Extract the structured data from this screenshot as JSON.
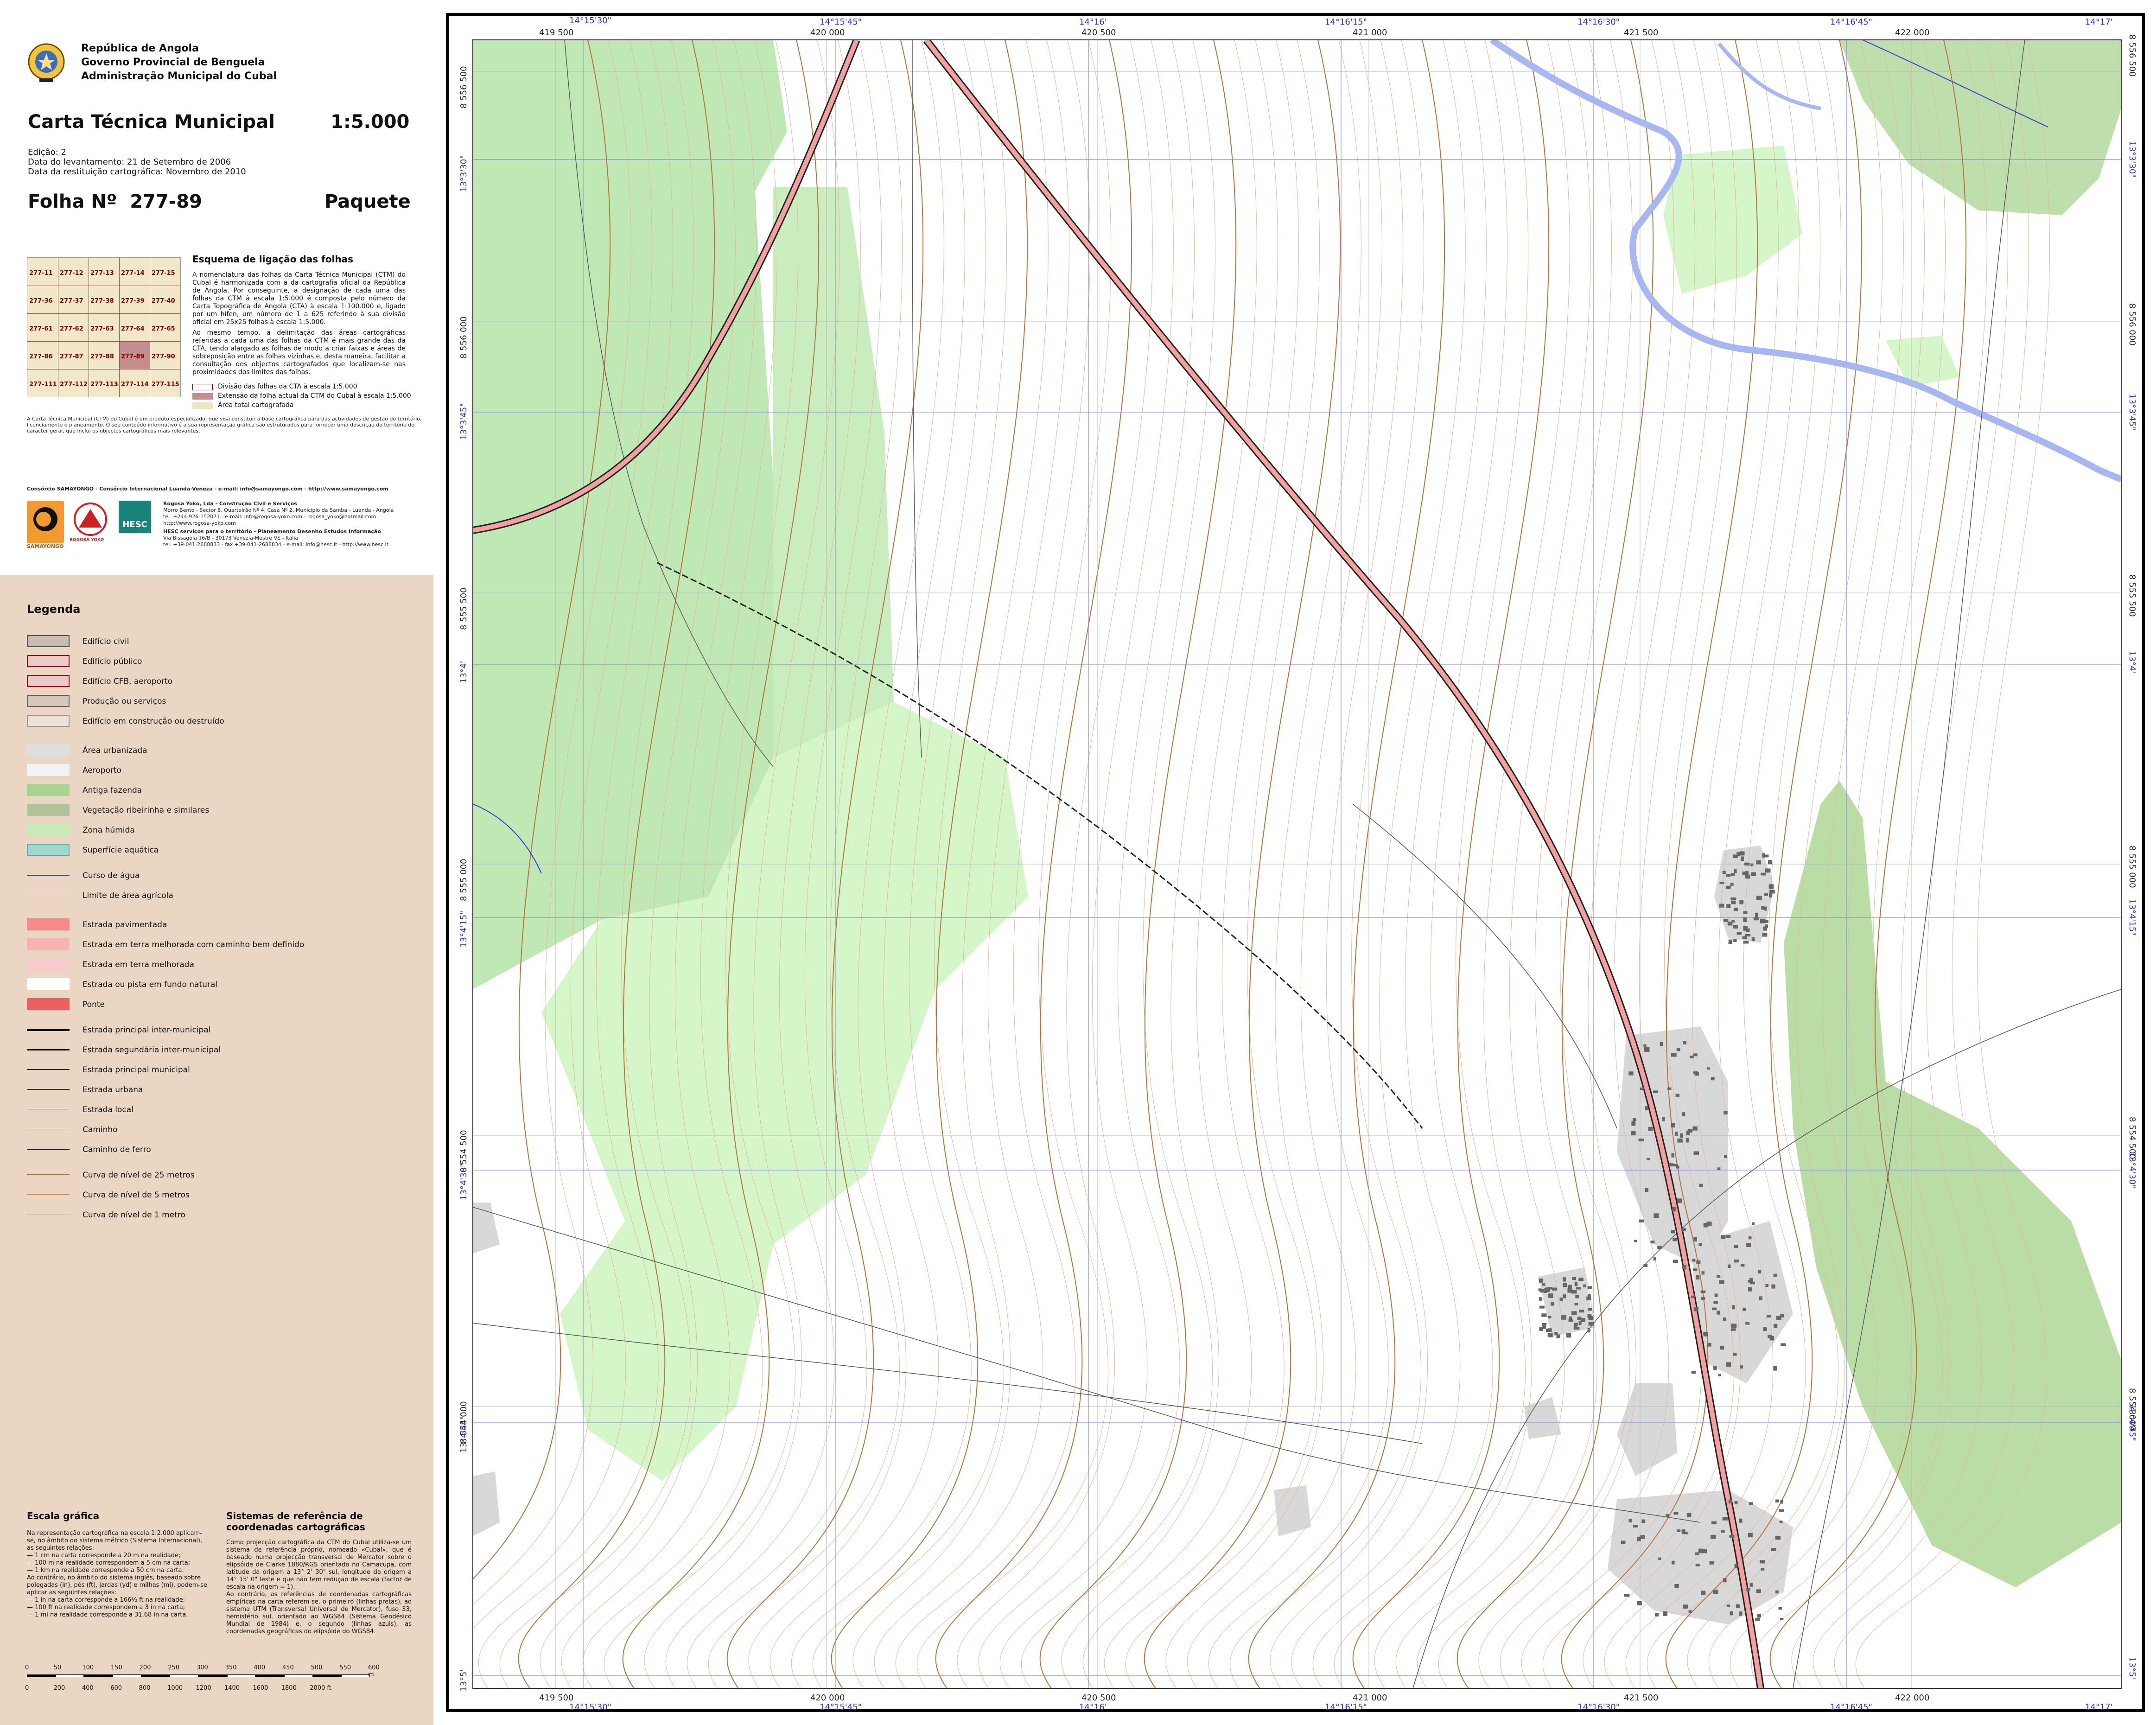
{
  "header": {
    "line1": "República de Angola",
    "line2": "Governo Provincial de Benguela",
    "line3": "Administração Municipal do Cubal",
    "map_title": "Carta Técnica Municipal",
    "scale": "1:5.000",
    "edition": "Edição: 2",
    "survey_date": "Data do levantamento: 21 de Setembro de 2006",
    "restitution_date": "Data da restituição cartográfica: Novembro de 2010",
    "sheet_label": "Folha Nº",
    "sheet_number": "277-89",
    "sheet_name": "Paquete"
  },
  "index_diagram": {
    "title": "Esquema de ligação das folhas",
    "cells": [
      [
        "277-11",
        "277-12",
        "277-13",
        "277-14",
        "277-15"
      ],
      [
        "277-36",
        "277-37",
        "277-38",
        "277-39",
        "277-40"
      ],
      [
        "277-61",
        "277-62",
        "277-63",
        "277-64",
        "277-65"
      ],
      [
        "277-86",
        "277-87",
        "277-88",
        "277-89",
        "277-90"
      ],
      [
        "277-111",
        "277-112",
        "277-113",
        "277-114",
        "277-115"
      ]
    ],
    "current_cell": "277-89",
    "text": "A nomenclatura das folhas da Carta Técnica Municipal (CTM) do Cubal é harmonizada com a da cartografia oficial da República de Angola. Por conseguinte, a designação de cada uma das folhas da CTM à escala 1:5.000 é composta pelo número da Carta Topográfica de Angola (CTA) à escala 1:100.000 e, ligado por um hífen, um número de 1 a 625 referindo à sua divisão oficial em 25x25 folhas à escala 1:5.000.",
    "text2": "Ao mesmo tempo, a delimitação das áreas cartográficas referidas a cada uma das folhas da CTM é mais grande das da CTA, tendo alargado as folhas de modo a criar faixas e áreas de sobreposição entre as folhas vizinhas e, desta maneira, facilitar a consultação dos objectos cartografados que localizam-se nas proximidades dos limites das folhas.",
    "legend1": "Divisão das folhas da CTA à escala 1:5.000",
    "legend2": "Extensão da folha actual da CTM do Cubal à escala 1:5.000",
    "legend3": "Área total cartografada"
  },
  "disclaimer": "A Carta Técnica Municipal (CTM) do Cubal é um produto especializado, que visa constituir a base cartográfica para das actividades de gestão do território, licenciamento e planeamento. O seu conteúdo informativo é a sua representação gráfica são estruturados para fornecer uma descrição do território de caracter geral, que inclui os objectos cartográficos mais relevantes.",
  "consortium": {
    "line": "Consórcio SAMAYONGO - Consórcio Internacional Luanda-Veneza - e-mail: info@samayongo.com - http://www.samayongo.com",
    "rogosa_name": "Rogosa Yoko, Lda - Construção Civil e Serviços",
    "rogosa_addr": "Morro Bento - Sector 8, Quarteirão Nº 4, Casa Nº 2, Município da Samba - Luanda - Angola",
    "rogosa_contact": "tel. +244-926-152071 - e-mail: info@rogosa-yoko.com - rogosa_yoko@hotmail.com",
    "rogosa_web": "http://www.rogosa-yoko.com",
    "hesc_name": "HESC serviços para o território - Planeamento Desenho Estudos Informação",
    "hesc_addr": "Via Bissagola 16/B - 30173 Venezia-Mestre VE - Itália",
    "hesc_contact": "tel. +39-041-2688833 - fax +39-041-2688834 - e-mail: info@hesc.it - http://www.hesc.it",
    "logo_left": "SAMAYONGO",
    "logo_mid": "ROGOSA YOKO",
    "logo_right": "HESC"
  },
  "legend": {
    "title": "Legenda",
    "items": [
      {
        "label": "Edifício civil",
        "fill": "#c9bcb2",
        "stroke": "#555"
      },
      {
        "label": "Edifício público",
        "fill": "#e8cccc",
        "stroke": "#b00000"
      },
      {
        "label": "Edifício CFB, aeroporto",
        "fill": "#e9c9c9",
        "stroke": "#b00000"
      },
      {
        "label": "Produção ou serviços",
        "fill": "#d8c7bb",
        "stroke": "#666"
      },
      {
        "label": "Edifício em construção ou destruído",
        "fill": "#f1e2d7",
        "stroke": "#999"
      },
      {
        "label": "Área urbanizada",
        "fill": "#dedede",
        "stroke": "none"
      },
      {
        "label": "Aeroporto",
        "fill": "#f2f2f2",
        "stroke": "none"
      },
      {
        "label": "Antiga fazenda",
        "fill": "#a8d48f",
        "stroke": "none"
      },
      {
        "label": "Vegetação ribeirinha e similares",
        "fill": "#b4c29a",
        "stroke": "none"
      },
      {
        "label": "Zona húmida",
        "fill": "#c8ecb8",
        "stroke": "none"
      },
      {
        "label": "Superfície aquática",
        "fill": "#9fd8d3",
        "stroke": "#6a9"
      },
      {
        "label": "Curso de água",
        "line": "#3a3ad8",
        "width": 2
      },
      {
        "label": "Limite de área agrícola",
        "line": "#999999",
        "width": 1
      },
      {
        "label": "Estrada pavimentada",
        "fill": "#f58a8a",
        "stroke": "none"
      },
      {
        "label": "Estrada em terra melhorada com caminho bem definido",
        "fill": "#f7b2b2",
        "stroke": "none"
      },
      {
        "label": "Estrada em terra melhorada",
        "fill": "#f8cccc",
        "stroke": "none"
      },
      {
        "label": "Estrada ou pista em fundo natural",
        "fill": "#ffffff",
        "stroke": "none"
      },
      {
        "label": "Ponte",
        "fill": "#ee5e5e",
        "stroke": "none"
      },
      {
        "label": "Estrada principal inter-municipal",
        "line": "#111111",
        "width": 4
      },
      {
        "label": "Estrada segundária inter-municipal",
        "line": "#111111",
        "width": 3
      },
      {
        "label": "Estrada principal municipal",
        "line": "#222222",
        "width": 2
      },
      {
        "label": "Estrada urbana",
        "line": "#333333",
        "width": 2
      },
      {
        "label": "Estrada local",
        "line": "#444444",
        "width": 1.5
      },
      {
        "label": "Caminho",
        "line": "#666666",
        "width": 1
      },
      {
        "label": "Caminho de ferro",
        "line": "#111111",
        "width": 2
      },
      {
        "label": "Curva de nível de 25 metros",
        "line": "#b36a2a",
        "width": 2
      },
      {
        "label": "Curva de nível de 5 metros",
        "line": "#c8885a",
        "width": 1
      },
      {
        "label": "Curva de nível de 1 metro",
        "line": "#e0bca0",
        "width": 1
      }
    ]
  },
  "scale_section": {
    "title": "Escala gráfica",
    "text": "Na representação cartográfica na escala 1:2.000 aplicam-se, no âmbito do sistema métrico (Sistema Internacional), as seguintes relações:\n— 1 cm na carta corresponde a 20 m na realidade;\n— 100 m na realidade correspondem a 5 cm na carta;\n— 1 km na realidade corresponde a 50 cm na carta.\nAo contrário, no âmbito do sistema inglês, baseado sobre polegadas (in), pés (ft), jardas (yd) e milhas (mi), podem-se aplicar as seguintes relações:\n— 1 in na carta corresponde a 166⅔ ft na realidade;\n— 100 ft na realidade correspondem a 3 in na carta;\n— 1 mi na realidade corresponde a 31,68 in na carta.",
    "meters_ticks": [
      "0",
      "50",
      "100",
      "150",
      "200",
      "250",
      "300",
      "350",
      "400",
      "450",
      "500",
      "550",
      "600 m"
    ],
    "feet_ticks": [
      "0",
      "200",
      "400",
      "600",
      "800",
      "1000",
      "1200",
      "1400",
      "1600",
      "1800",
      "2000 ft"
    ]
  },
  "crs_section": {
    "title": "Sistemas de referência de coordenadas cartográficas",
    "text": "Como projecção cartográfica da CTM do Cubal utiliza-se um sistema de referência próprio, nomeado «Cubal», que é baseado numa projecção transversal de Mercator sobre o elipsóide de Clarke 1880/RGS orientado no Camacupa, com latitude da origem a 13° 2' 30\" sul, longitude da origem a 14° 15' 0\" leste e que não tem redução de escala (factor de escala na origem = 1).\nAo contrário, as referências de coordenadas cartográficas empíricas na carta referem-se, o primeiro (linhas pretas), ao sistema UTM (Transversal Universal de Mercator), fuso 33, hemisfério sul, orientado ao WGS84 (Sistema Geodésico Mundial de 1984) e, o segundo (linhas azuis), as coordenadas geográficas do elipsóide do WGS84."
  },
  "map": {
    "top_easting": [
      "419 500",
      "420 000",
      "420 500",
      "421 000",
      "421 500",
      "422 000"
    ],
    "top_longitude": [
      "14°15'30\"",
      "14°15'45\"",
      "14°16'",
      "14°16'15\"",
      "14°16'30\"",
      "14°16'45\"",
      "14°17'"
    ],
    "left_northing": [
      "8 556 500",
      "8 556 000",
      "8 555 500",
      "8 555 000",
      "8 554 500",
      "8 554 000"
    ],
    "right_latitude": [
      "13°3'30\"",
      "13°3'45\"",
      "13°4'",
      "13°4'15\"",
      "13°4'30\"",
      "13°4'45\"",
      "13°5'"
    ],
    "colors": {
      "farm": "#a8d48f",
      "wet": "#c8ecb8",
      "urban": "#dcdcdc",
      "river": "#9ab0ee",
      "road_paved": "#f3a0a0",
      "contour_major": "#b8733a",
      "contour_minor": "#d6a27e",
      "grid_utm": "#b5b5b5",
      "grid_geo": "#8a8ae6"
    }
  }
}
